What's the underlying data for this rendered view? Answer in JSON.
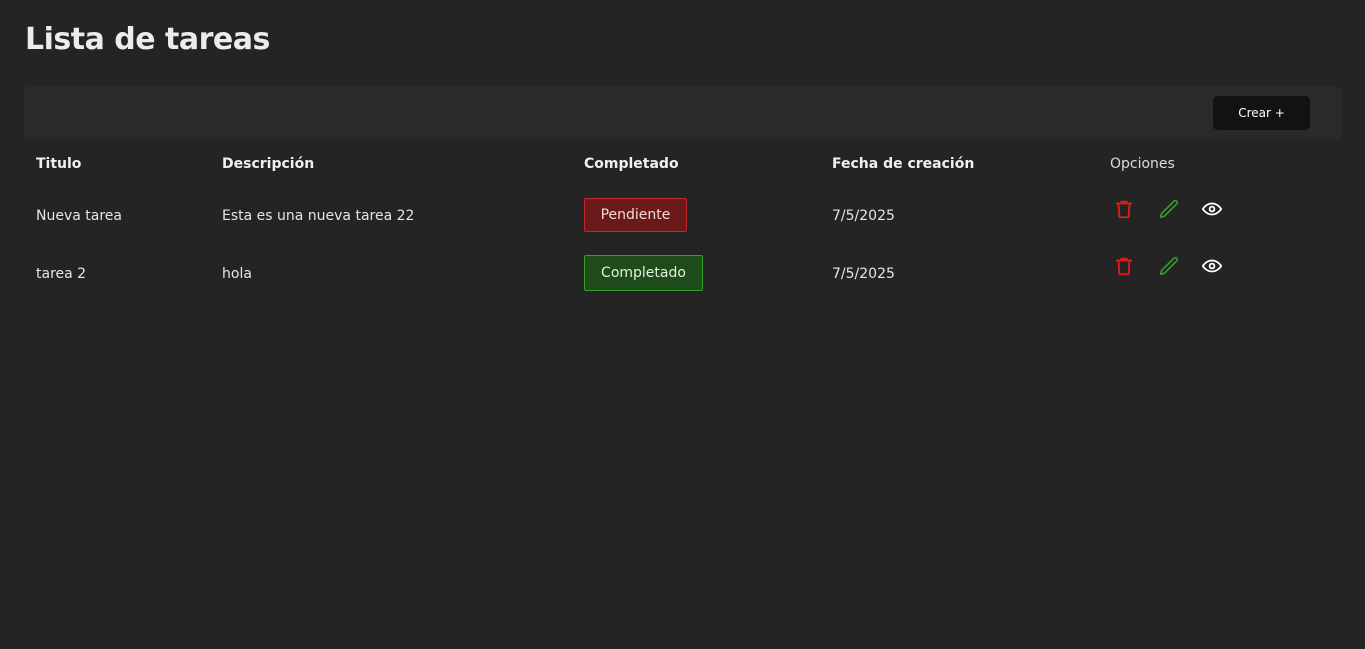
{
  "header": {
    "title": "Lista de tareas"
  },
  "toolbar": {
    "create_label": "Crear +"
  },
  "table": {
    "columns": [
      "Titulo",
      "Descripción",
      "Completado",
      "Fecha de creación",
      "Opciones"
    ],
    "rows": [
      {
        "titulo": "Nueva tarea",
        "descripcion": "Esta es una nueva tarea 22",
        "completado": "Pendiente",
        "status": "pending",
        "fecha": "7/5/2025"
      },
      {
        "titulo": "tarea 2",
        "descripcion": "hola",
        "completado": "Completado",
        "status": "done",
        "fecha": "7/5/2025"
      }
    ]
  },
  "colors": {
    "background": "#242424",
    "delete": "#e01b1b",
    "edit": "#2fa12a",
    "view": "#ffffff",
    "pending_bg": "#6b1a1a",
    "done_bg": "#1f4a1a"
  },
  "icons": {
    "delete": "trash-icon",
    "edit": "pencil-icon",
    "view": "eye-icon"
  }
}
